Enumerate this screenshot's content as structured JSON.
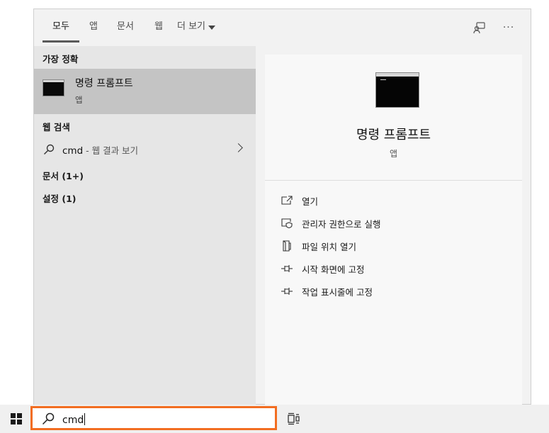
{
  "tabs": [
    {
      "label": "모두"
    },
    {
      "label": "앱"
    },
    {
      "label": "문서"
    },
    {
      "label": "웹"
    },
    {
      "label": "더 보기"
    }
  ],
  "icons": {
    "feedback": "feedback-icon",
    "more": "more-options-icon",
    "search": "search-icon",
    "windows": "windows-start-icon",
    "taskview": "task-view-icon"
  },
  "more_glyph": "···",
  "left": {
    "best_match_header": "가장 정확",
    "best_match": {
      "title": "명령 프롬프트",
      "subtitle": "앱"
    },
    "web_header": "웹 검색",
    "web_result": {
      "query": "cmd",
      "suffix": " - 웹 결과 보기"
    },
    "documents": "문서 (1+)",
    "settings": "설정 (1)"
  },
  "preview": {
    "title": "명령 프롬프트",
    "subtitle": "앱"
  },
  "actions": [
    {
      "label": "열기",
      "icon": "open-icon"
    },
    {
      "label": "관리자 권한으로 실행",
      "icon": "run-as-admin-icon"
    },
    {
      "label": "파일 위치 열기",
      "icon": "file-location-icon"
    },
    {
      "label": "시작 화면에 고정",
      "icon": "pin-icon"
    },
    {
      "label": "작업 표시줄에 고정",
      "icon": "pin-icon"
    }
  ],
  "taskbar": {
    "search_value": "cmd"
  },
  "colors": {
    "search_border": "#f26d21",
    "selected_row": "#c4c4c4",
    "left_bg": "#e6e6e6",
    "right_bg": "#f8f8f8"
  }
}
